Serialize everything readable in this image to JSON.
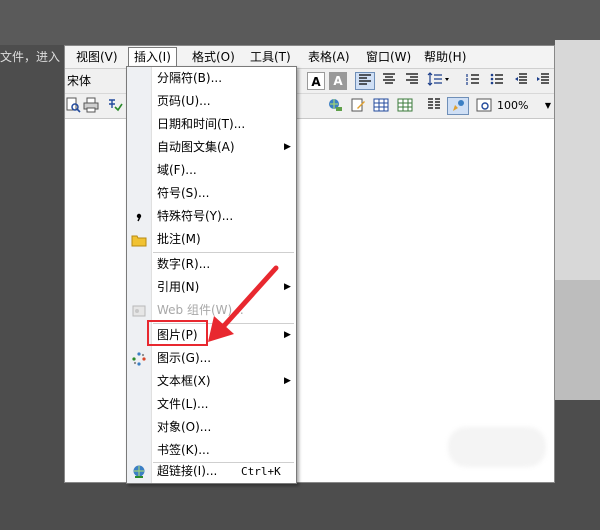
{
  "background": {
    "left_text": "文件，进入"
  },
  "menubar": {
    "items": [
      "视图(V)",
      "插入(I)",
      "格式(O)",
      "工具(T)",
      "表格(A)",
      "窗口(W)",
      "帮助(H)"
    ],
    "active": "插入(I)"
  },
  "toolbar": {
    "font_name": "宋体",
    "align_buttons": [
      "A",
      "A"
    ],
    "zoom": "100%"
  },
  "dropdown": {
    "items": [
      {
        "label": "分隔符(B)...",
        "icon": ""
      },
      {
        "label": "页码(U)...",
        "icon": ""
      },
      {
        "label": "日期和时间(T)...",
        "icon": ""
      },
      {
        "label": "自动图文集(A)",
        "icon": "",
        "submenu": "▶"
      },
      {
        "label": "域(F)...",
        "icon": ""
      },
      {
        "label": "符号(S)...",
        "icon": ""
      },
      {
        "label": "特殊符号(Y)...",
        "icon": "special-symbol-icon"
      },
      {
        "label": "批注(M)",
        "icon": "comment-folder-icon"
      },
      {
        "label": "数字(R)...",
        "icon": ""
      },
      {
        "label": "引用(N)",
        "icon": "",
        "submenu": "▶"
      },
      {
        "label": "Web 组件(W)...",
        "icon": "web-component-icon",
        "disabled": true
      },
      {
        "label": "图片(P)",
        "icon": "",
        "submenu": "▶"
      },
      {
        "label": "图示(G)...",
        "icon": "diagram-icon"
      },
      {
        "label": "文本框(X)",
        "icon": "",
        "submenu": "▶"
      },
      {
        "label": "文件(L)...",
        "icon": ""
      },
      {
        "label": "对象(O)...",
        "icon": ""
      },
      {
        "label": "书签(K)...",
        "icon": ""
      },
      {
        "label": "超链接(I)...",
        "icon": "hyperlink-icon",
        "shortcut": "Ctrl+K"
      }
    ],
    "highlighted": "图片(P)"
  },
  "colors": {
    "highlight": "#e8282f",
    "menu_bg": "#f3f3f3",
    "icon_column": "#eef0f3"
  }
}
